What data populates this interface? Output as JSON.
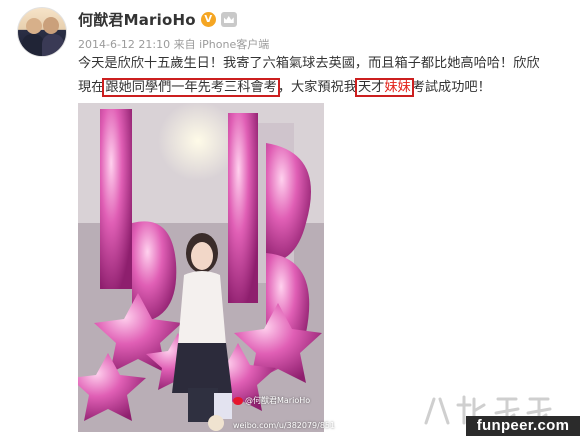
{
  "post": {
    "user_name": "何猷君MarioHo",
    "verified_badge": "V",
    "timestamp": "2014-6-12 21:10",
    "source": "来自 iPhone客户端",
    "text_line1": "今天是欣欣十五歲生日！我寄了六箱氣球去英國，而且箱子都比她高哈哈！欣欣",
    "text_line2_a": "現在",
    "text_line2_boxed1": "跟她同學們一年先考三科會考",
    "text_line2_b": "，大家預祝我",
    "text_line2_boxed2_a": "天才",
    "text_line2_boxed2_red": "妹妹",
    "text_line2_c": "考試成功吧！"
  },
  "photo_watermark": {
    "handle": "@何猷君MarioHo",
    "url": "weibo.com/u/382079/851"
  },
  "site_watermark": {
    "url": "funpeer.com"
  },
  "colors": {
    "highlight_box": "#cc1f1f",
    "red_text": "#e2231a",
    "verified": "#f5a623",
    "meta_grey": "#9b9b9b"
  },
  "icons": [
    "verified-icon",
    "member-crown-icon",
    "weibo-logo-icon"
  ]
}
